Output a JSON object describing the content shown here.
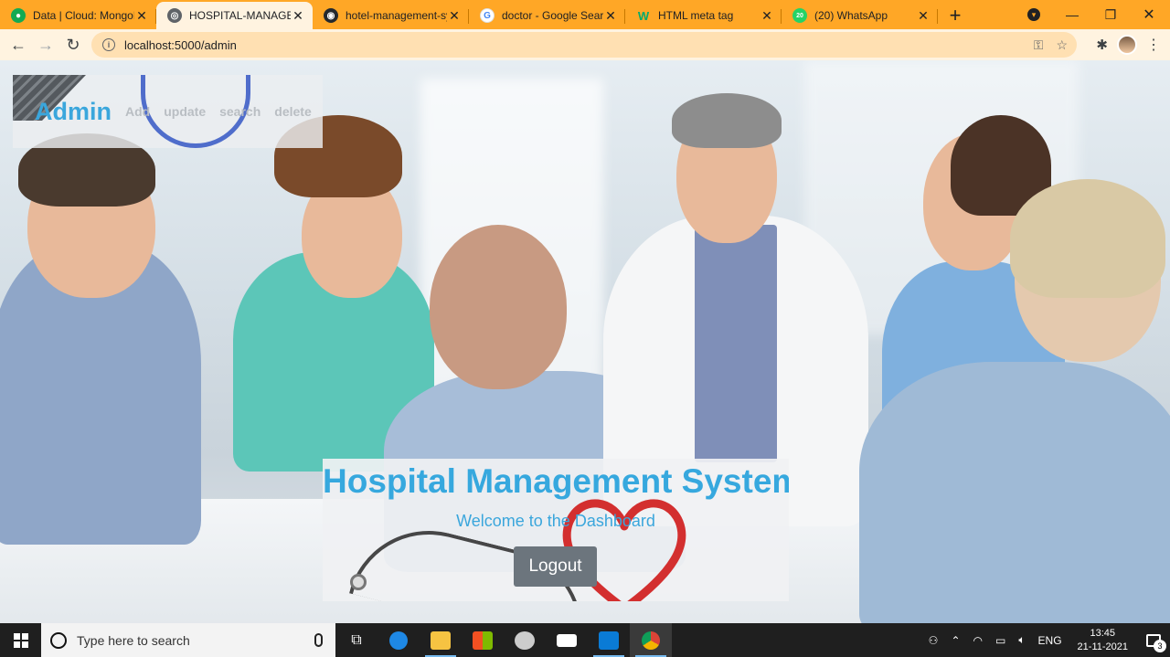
{
  "browser": {
    "tabs": [
      {
        "title": "Data | Cloud: MongoDB",
        "icon": "mongodb-leaf-icon",
        "color": "#13aa52",
        "active": false
      },
      {
        "title": "HOSPITAL-MANAGEMENT",
        "icon": "globe-icon",
        "color": "#5f6368",
        "active": true
      },
      {
        "title": "hotel-management-system",
        "icon": "github-icon",
        "color": "#24292e",
        "active": false
      },
      {
        "title": "doctor - Google Search",
        "icon": "google-icon",
        "color": "#4285f4",
        "active": false
      },
      {
        "title": "HTML meta tag",
        "icon": "w3schools-icon",
        "color": "#04aa6d",
        "active": false
      },
      {
        "title": "(20) WhatsApp",
        "icon": "whatsapp-icon",
        "color": "#25d366",
        "badge": "20",
        "active": false
      }
    ],
    "new_tab": "+",
    "url": "localhost:5000/admin",
    "accent": "#ffa726"
  },
  "page": {
    "nav": {
      "brand": "Admin",
      "links": [
        "Add",
        "update",
        "search",
        "delete"
      ]
    },
    "card": {
      "title": "Hospital Management System",
      "subtitle": "Welcome to the Dashboard",
      "logout": "Logout"
    },
    "colors": {
      "title": "#36a8de",
      "button": "#6c757d"
    }
  },
  "taskbar": {
    "search_placeholder": "Type here to search",
    "tray": {
      "language": "ENG",
      "time": "13:45",
      "date": "21-11-2021",
      "notifications": "3"
    }
  }
}
